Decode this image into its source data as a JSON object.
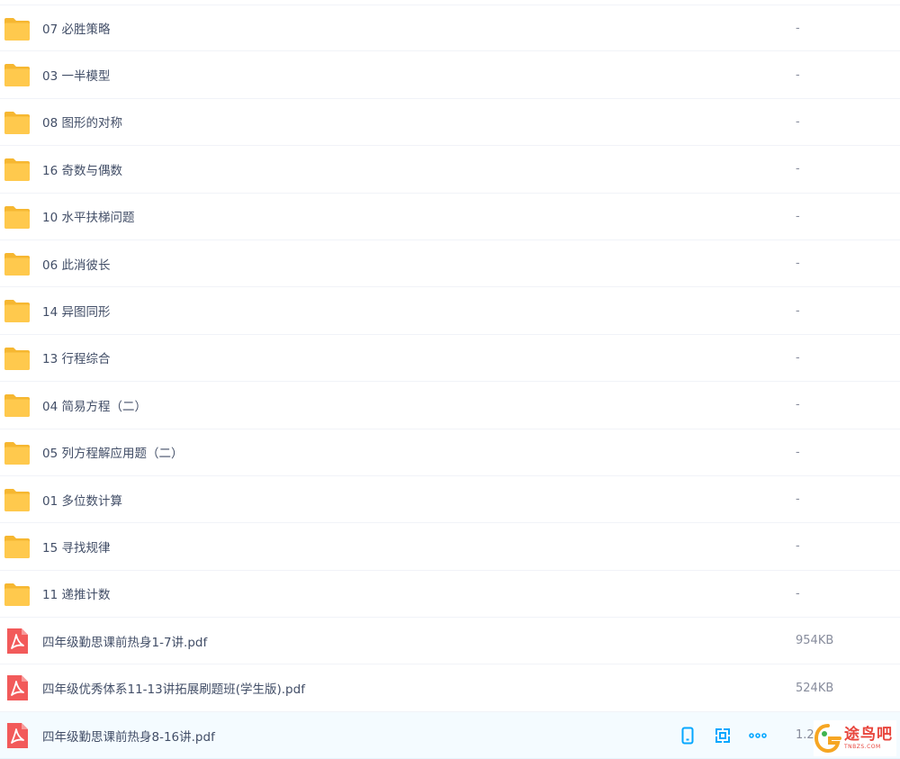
{
  "files": [
    {
      "type": "folder",
      "name": "07 必胜策略",
      "size": "-"
    },
    {
      "type": "folder",
      "name": "03 一半模型",
      "size": "-"
    },
    {
      "type": "folder",
      "name": "08 图形的对称",
      "size": "-"
    },
    {
      "type": "folder",
      "name": "16 奇数与偶数",
      "size": "-"
    },
    {
      "type": "folder",
      "name": "10 水平扶梯问题",
      "size": "-"
    },
    {
      "type": "folder",
      "name": "06 此消彼长",
      "size": "-"
    },
    {
      "type": "folder",
      "name": "14 异图同形",
      "size": "-"
    },
    {
      "type": "folder",
      "name": "13 行程综合",
      "size": "-"
    },
    {
      "type": "folder",
      "name": "04 简易方程（二）",
      "size": "-"
    },
    {
      "type": "folder",
      "name": "05 列方程解应用题（二）",
      "size": "-"
    },
    {
      "type": "folder",
      "name": "01 多位数计算",
      "size": "-"
    },
    {
      "type": "folder",
      "name": "15 寻找规律",
      "size": "-"
    },
    {
      "type": "folder",
      "name": "11 递推计数",
      "size": "-"
    },
    {
      "type": "pdf",
      "name": "四年级勤思课前热身1-7讲.pdf",
      "size": "954KB"
    },
    {
      "type": "pdf",
      "name": "四年级优秀体系11-13讲拓展刷题班(学生版).pdf",
      "size": "524KB"
    },
    {
      "type": "pdf",
      "name": "四年级勤思课前热身8-16讲.pdf",
      "size": "1.2",
      "hover": true
    }
  ],
  "row_actions": [
    "phone-icon",
    "share-link-icon",
    "more-icon"
  ],
  "watermark": {
    "main": "途鸟吧",
    "sub": "TNBZS.COM"
  },
  "colors": {
    "folder": "#ffc94d",
    "folder_dark": "#f6b731",
    "pdf": "#f25a5a",
    "accent": "#06a7ff"
  }
}
